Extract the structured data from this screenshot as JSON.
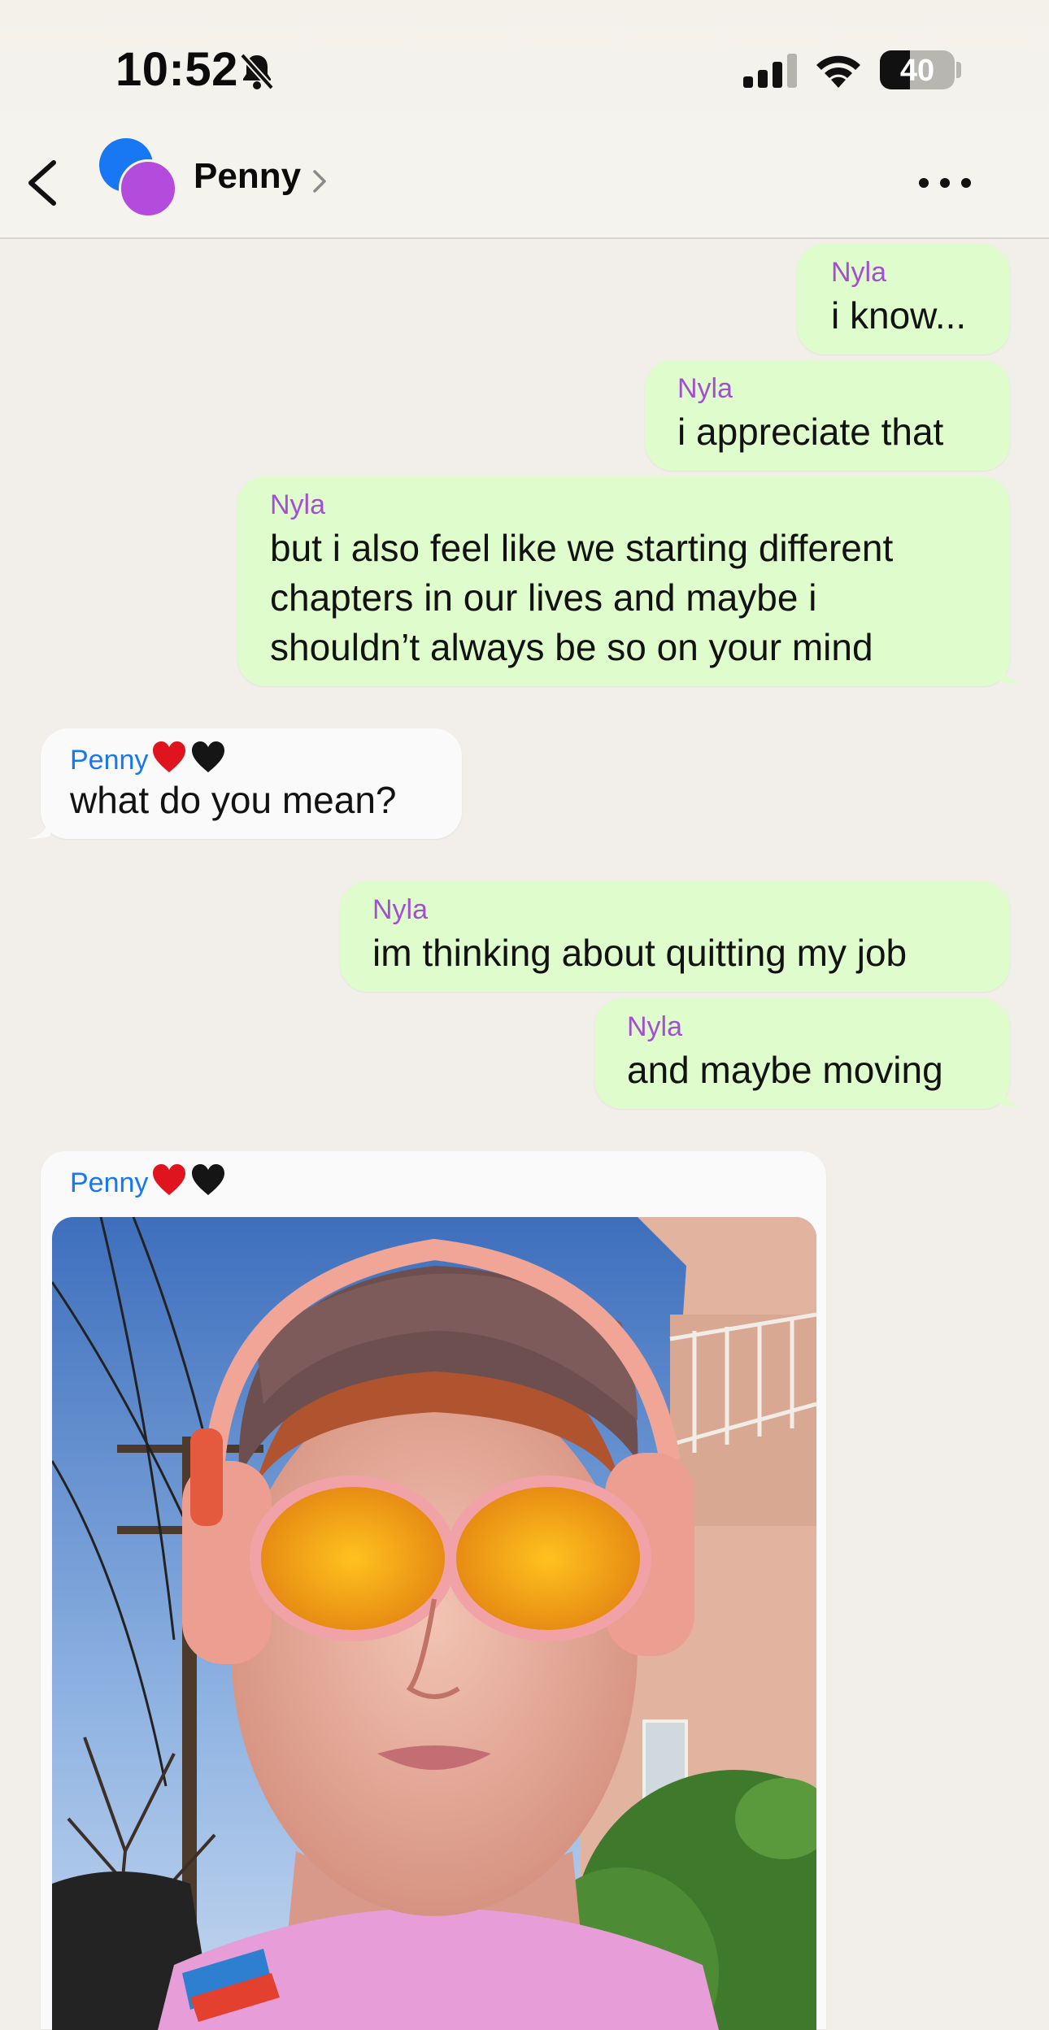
{
  "status_bar": {
    "time": "10:52",
    "battery_percent": "40",
    "battery_level": 0.4
  },
  "header": {
    "contact_name": "Penny",
    "avatar_colors": [
      "#1877f2",
      "#b34bdc"
    ]
  },
  "colors": {
    "sent_bubble": "#dffccc",
    "received_bubble": "#fafafa",
    "nyla_name": "#a24fd2",
    "penny_name": "#1877f2",
    "background": "#f2efea"
  },
  "messages": [
    {
      "sender": "Nyla",
      "direction": "sent",
      "lines": [
        "i know..."
      ]
    },
    {
      "sender": "Nyla",
      "direction": "sent",
      "lines": [
        "i appreciate that"
      ]
    },
    {
      "sender": "Nyla",
      "direction": "sent",
      "lines": [
        "but i also feel like we starting different",
        "chapters in our lives and maybe i",
        "shouldn’t always be so on your mind"
      ]
    },
    {
      "sender": "Penny",
      "sender_emoji": [
        "red-heart",
        "black-heart"
      ],
      "direction": "received",
      "lines": [
        "what do you mean?"
      ]
    },
    {
      "sender": "Nyla",
      "direction": "sent",
      "lines": [
        "im thinking about quitting my job"
      ]
    },
    {
      "sender": "Nyla",
      "direction": "sent",
      "lines": [
        "and maybe moving"
      ]
    },
    {
      "sender": "Penny",
      "sender_emoji": [
        "red-heart",
        "black-heart"
      ],
      "direction": "received",
      "type": "photo"
    }
  ]
}
